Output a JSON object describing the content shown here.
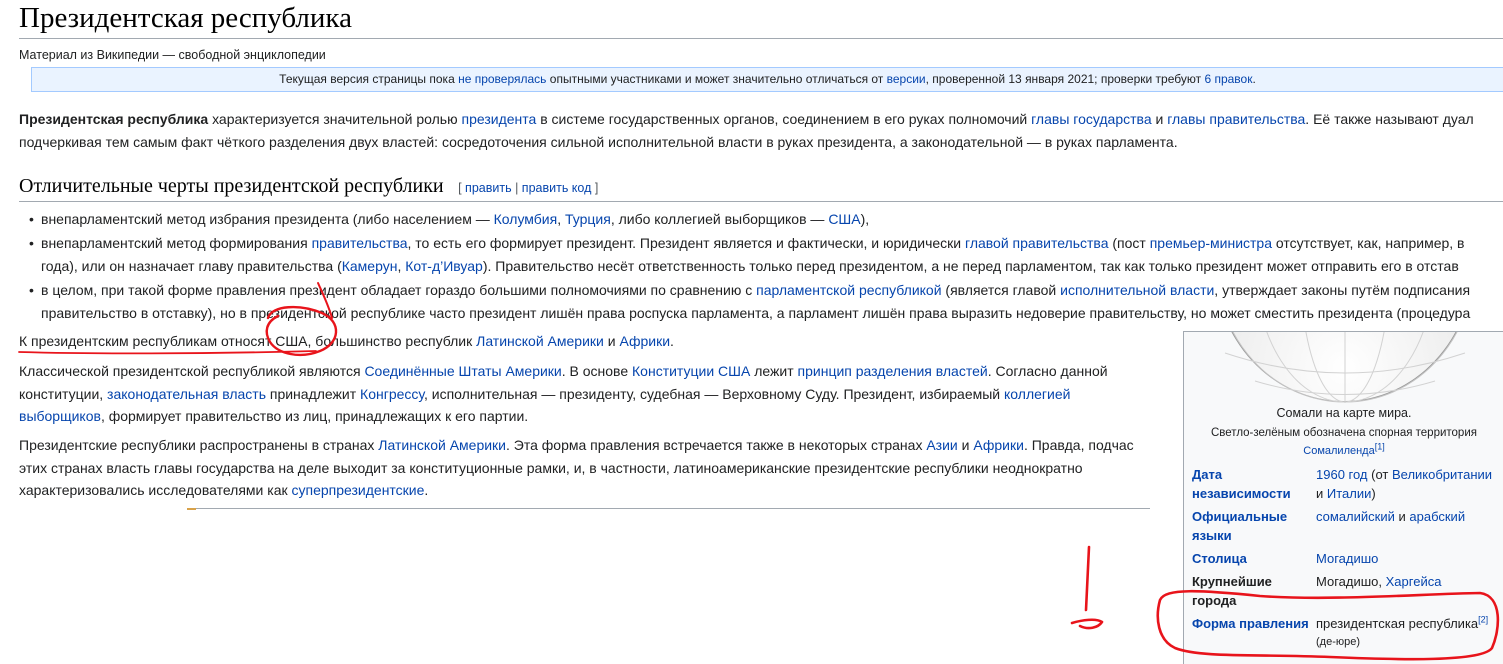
{
  "page": {
    "title": "Президентская республика",
    "tagline": "Материал из Википедии — свободной энциклопедии"
  },
  "notice": {
    "t1": "Текущая версия страницы пока ",
    "l1": "не проверялась",
    "t2": " опытными участниками и может значительно отличаться от ",
    "l2": "версии",
    "t3": ", проверенной 13 января 2021; проверки требуют ",
    "l3": "6 правок",
    "t4": "."
  },
  "intro": {
    "line1_bold": "Президентская республика",
    "line1_t1": " характеризуется значительной ролью ",
    "line1_l1": "президента",
    "line1_t2": " в системе государственных органов, соединением в его руках полномочий ",
    "line1_l2": "главы государства",
    "line1_t3": " и ",
    "line1_l3": "главы правительства",
    "line1_t4": ". Её также называют дуал",
    "line2": "подчеркивая тем самым факт чёткого разделения двух властей: сосредоточения сильной исполнительной власти в руках президента, а законодательной — в руках парламента."
  },
  "section": {
    "heading": "Отличительные черты президентской республики",
    "edit_open": "[ ",
    "edit_link": "править",
    "edit_sep": " | ",
    "edit_code": "править код",
    "edit_close": " ]"
  },
  "bullets": {
    "b1_t1": "внепарламентский метод избрания президента (либо населением — ",
    "b1_l1": "Колумбия",
    "b1_t2": ", ",
    "b1_l2": "Турция",
    "b1_t3": ", либо коллегией выборщиков — ",
    "b1_l3": "США",
    "b1_t4": "),",
    "b2_t1": "внепарламентский метод формирования ",
    "b2_l1": "правительства",
    "b2_t2": ", то есть его формирует президент. Президент является и фактически, и юридически ",
    "b2_l2": "главой правительства",
    "b2_t3": " (пост ",
    "b2_l3": "премьер-министра",
    "b2_t4": " отсутствует, как, например, в",
    "b2_line2_t1": "года), или он назначает главу правительства (",
    "b2_line2_l1": "Камерун",
    "b2_line2_t2": ", ",
    "b2_line2_l2": "Кот-д’Ивуар",
    "b2_line2_t3": "). Правительство несёт ответственность только перед президентом, а не перед парламентом, так как только президент может отправить его в отстав",
    "b3_t1": "в целом, при такой форме правления президент обладает гораздо большими полномочиями по сравнению с ",
    "b3_l1": "парламентской республикой",
    "b3_t2": " (является главой ",
    "b3_l2": "исполнительной власти",
    "b3_t3": ", утверждает законы путём подписания",
    "b3_line2": "правительство в отставку), но в президентской республике часто президент лишён права роспуска парламента, а парламент лишён права выразить недоверие правительству, но может сместить президента (процедура"
  },
  "p_countries": {
    "t1": "К президентским республикам относят США, большинство республик ",
    "l1": "Латинской Америки",
    "t2": " и ",
    "l2": "Африки",
    "t3": "."
  },
  "p_usa": {
    "t1": "Классической президентской республикой являются ",
    "l1": "Соединённые Штаты Америки",
    "t2": ". В основе ",
    "l2": "Конституции США",
    "t3": " лежит ",
    "l3": "принцип разделения властей",
    "t4": ". Согласно данной",
    "line2_t1": "конституции, ",
    "line2_l1": "законодательная власть",
    "line2_t2": " принадлежит ",
    "line2_l2": "Конгрессу",
    "line2_t3": ", исполнительная — президенту, судебная — Верховному Суду. Президент, избираемый ",
    "line2_l3": "коллегией",
    "line3_l1": "выборщиков",
    "line3_t1": ", формирует правительство из лиц, принадлежащих к его партии."
  },
  "p_spread": {
    "t1": "Президентские республики распространены в странах ",
    "l1": "Латинской Америки",
    "t2": ". Эта форма правления встречается также в некоторых странах ",
    "l2": "Азии",
    "t3": " и ",
    "l3": "Африки",
    "t4": ". Правда, подчас",
    "line2": "этих странах власть главы государства на деле выходит за конституционные рамки, и, в частности, латиноамериканские президентские республики неоднократно",
    "line3_t1": "характеризовались исследователями как ",
    "line3_l1": "суперпрезидентские",
    "line3_t2": "."
  },
  "infobox": {
    "caption": "Сомали на карте мира.",
    "caption_note": "Светло-зелёным обозначена спорная территория",
    "caption_link": "Сомалиленда",
    "caption_ref": "[1]",
    "independence_label": "Дата независимости",
    "independence_year": "1960 год",
    "independence_t1": " (от ",
    "independence_l1": "Великобритании",
    "independence_t2": "и ",
    "independence_l2": "Италии",
    "independence_t3": ")",
    "languages_label": "Официальные языки",
    "languages_l1": "сомалийский",
    "languages_t1": " и ",
    "languages_l2": "арабский",
    "capital_label": "Столица",
    "capital_value": "Могадишо",
    "cities_label": "Крупнейшие города",
    "cities_t1": "Могадишо, ",
    "cities_l1": "Харгейса",
    "govform_label": "Форма правления",
    "govform_value": "президентская республика",
    "govform_ref": "[2]",
    "govform_note": "(де-юре)"
  },
  "annotation_colors": {
    "ink": "#e8141b"
  }
}
